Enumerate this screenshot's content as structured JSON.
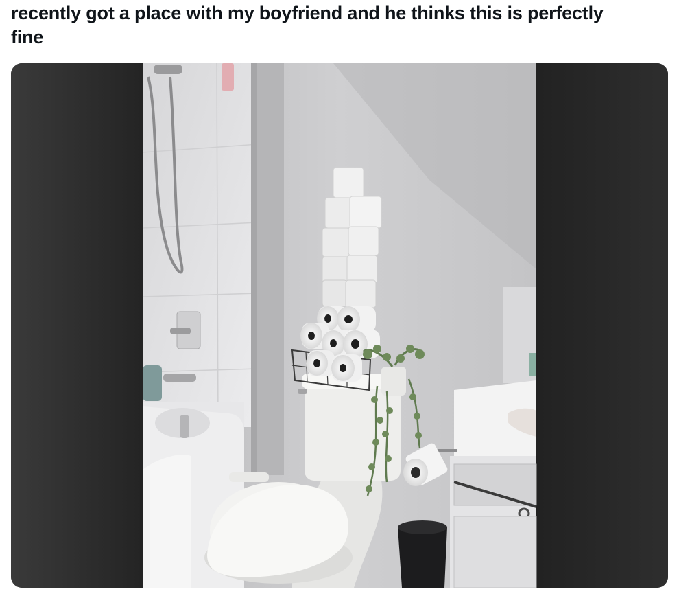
{
  "post": {
    "title": "recently got a place with my boyfriend and he thinks this is perfectly fine"
  },
  "media": {
    "kind": "photo",
    "subject": "bathroom-toilet-paper-stack",
    "colors": {
      "backdrop_left": "#2e2e2e",
      "backdrop_right": "#262626",
      "wall": "#c8c8ca",
      "tile": "#e6e6e8",
      "porcelain": "#f1f1ef",
      "plant": "#5f7a4f"
    }
  }
}
